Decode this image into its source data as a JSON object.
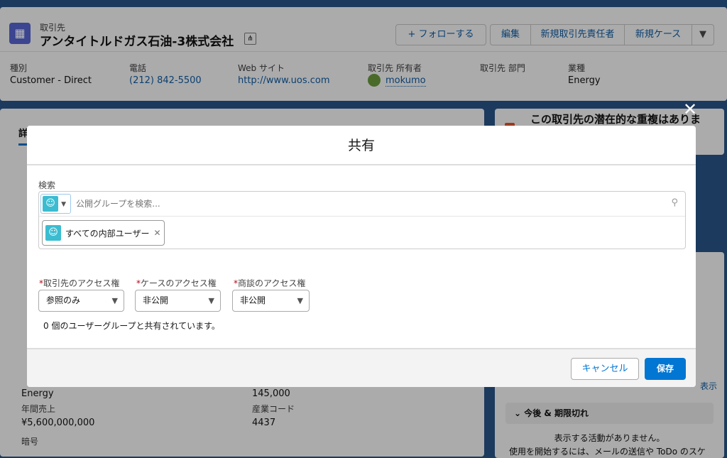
{
  "header": {
    "object_type": "取引先",
    "title": "アンタイトルドガス石油-3株式会社",
    "buttons": {
      "follow": "+ フォローする",
      "edit": "編集",
      "new_contact": "新規取引先責任者",
      "new_case": "新規ケース"
    },
    "fields": [
      {
        "label": "種別",
        "value": "Customer - Direct"
      },
      {
        "label": "電話",
        "value": "(212) 842-5500"
      },
      {
        "label": "Web サイト",
        "value": "http://www.uos.com"
      },
      {
        "label": "取引先 所有者",
        "value": "mokumo"
      },
      {
        "label": "取引先 部門",
        "value": ""
      },
      {
        "label": "業種",
        "value": "Energy"
      }
    ]
  },
  "detail": {
    "tab": "詳",
    "industry_value": "Energy",
    "employees_value": "145,000",
    "annual_revenue_label": "年間売上",
    "annual_revenue_value": "¥5,600,000,000",
    "sic_label": "産業コード",
    "sic_value": "4437",
    "ticker_label": "暗号"
  },
  "side": {
    "duplicate_title": "この取引先の潜在的な重複はありま",
    "show_all": "表示",
    "upcoming": "今後 & 期限切れ",
    "no_activity": "表示する活動がありません。",
    "hint": "使用を開始するには、メールの送信や ToDo のスケ"
  },
  "modal": {
    "title": "共有",
    "search_label": "検索",
    "search_placeholder": "公開グループを検索...",
    "pill": "すべての内部ユーザー",
    "access": [
      {
        "label": "取引先のアクセス権",
        "value": "参照のみ"
      },
      {
        "label": "ケースのアクセス権",
        "value": "非公開"
      },
      {
        "label": "商談のアクセス権",
        "value": "非公開"
      }
    ],
    "shared_count": "0 個のユーザーグループと共有されています。",
    "cancel": "キャンセル",
    "save": "保存"
  },
  "colors": {
    "brand": "#0176d3",
    "group_icon": "#3bbcd0",
    "account_icon": "#5867e8"
  }
}
